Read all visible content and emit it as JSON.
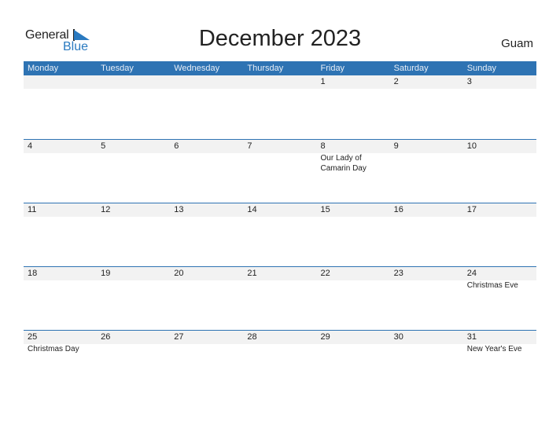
{
  "logo": {
    "general": "General",
    "blue": "Blue"
  },
  "title": "December 2023",
  "region": "Guam",
  "colors": {
    "header": "#2e73b3",
    "strip": "#f2f2f2",
    "logo_blue": "#2a7ac0"
  },
  "weekdays": [
    "Monday",
    "Tuesday",
    "Wednesday",
    "Thursday",
    "Friday",
    "Saturday",
    "Sunday"
  ],
  "weeks": [
    [
      {
        "d": "",
        "e": ""
      },
      {
        "d": "",
        "e": ""
      },
      {
        "d": "",
        "e": ""
      },
      {
        "d": "",
        "e": ""
      },
      {
        "d": "1",
        "e": ""
      },
      {
        "d": "2",
        "e": ""
      },
      {
        "d": "3",
        "e": ""
      }
    ],
    [
      {
        "d": "4",
        "e": ""
      },
      {
        "d": "5",
        "e": ""
      },
      {
        "d": "6",
        "e": ""
      },
      {
        "d": "7",
        "e": ""
      },
      {
        "d": "8",
        "e": "Our Lady of Camarin Day"
      },
      {
        "d": "9",
        "e": ""
      },
      {
        "d": "10",
        "e": ""
      }
    ],
    [
      {
        "d": "11",
        "e": ""
      },
      {
        "d": "12",
        "e": ""
      },
      {
        "d": "13",
        "e": ""
      },
      {
        "d": "14",
        "e": ""
      },
      {
        "d": "15",
        "e": ""
      },
      {
        "d": "16",
        "e": ""
      },
      {
        "d": "17",
        "e": ""
      }
    ],
    [
      {
        "d": "18",
        "e": ""
      },
      {
        "d": "19",
        "e": ""
      },
      {
        "d": "20",
        "e": ""
      },
      {
        "d": "21",
        "e": ""
      },
      {
        "d": "22",
        "e": ""
      },
      {
        "d": "23",
        "e": ""
      },
      {
        "d": "24",
        "e": "Christmas Eve"
      }
    ],
    [
      {
        "d": "25",
        "e": "Christmas Day"
      },
      {
        "d": "26",
        "e": ""
      },
      {
        "d": "27",
        "e": ""
      },
      {
        "d": "28",
        "e": ""
      },
      {
        "d": "29",
        "e": ""
      },
      {
        "d": "30",
        "e": ""
      },
      {
        "d": "31",
        "e": "New Year's Eve"
      }
    ]
  ]
}
